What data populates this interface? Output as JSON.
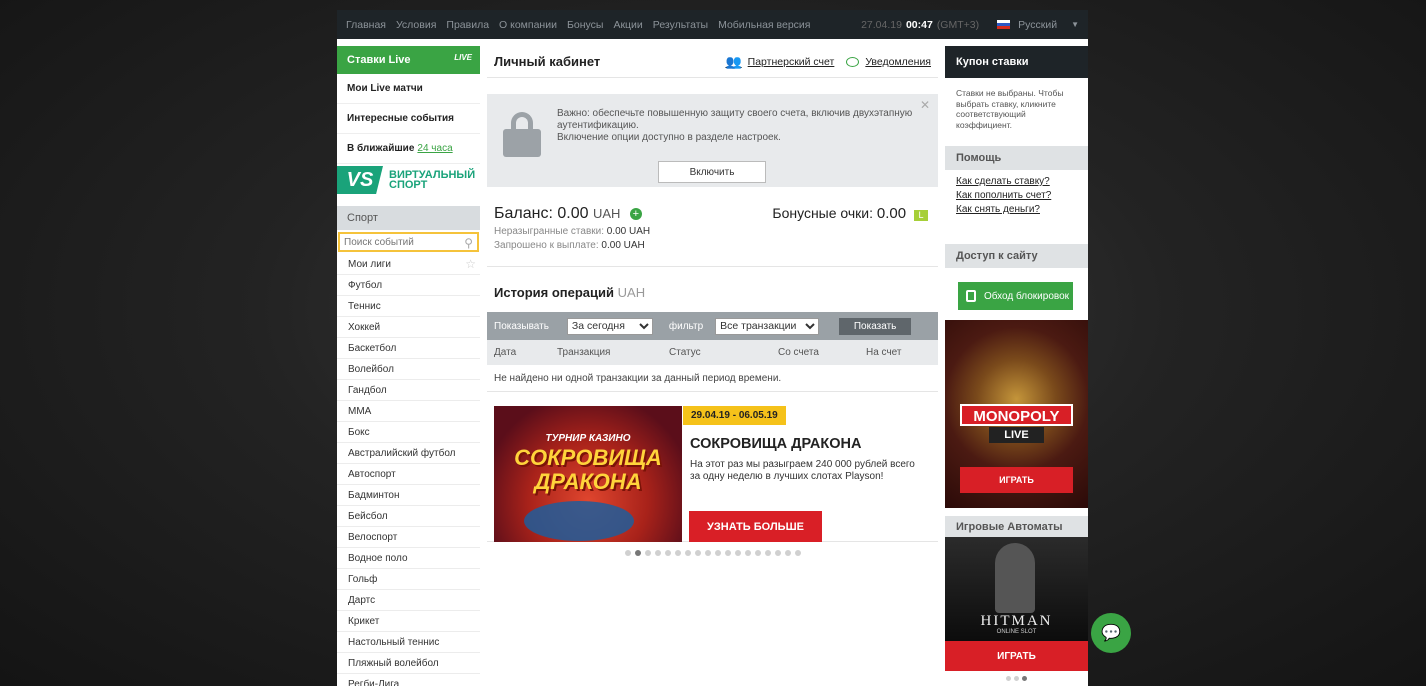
{
  "topnav": {
    "items": [
      "Главная",
      "Условия",
      "Правила",
      "О компании",
      "Бонусы",
      "Акции",
      "Результаты",
      "Мобильная версия"
    ],
    "date": "27.04.19",
    "time": "00:47",
    "timezone": "(GMT+3)",
    "language": "Русский"
  },
  "left": {
    "live_title": "Ставки Live",
    "live_badge": "LIVE",
    "my_live": "Мои Live матчи",
    "interesting": "Интересные события",
    "upcoming": "В ближайшие",
    "upcoming_link": "24 часа",
    "vs_logo": "VS",
    "vs_text_1": "ВИРТУАЛЬНЫЙ",
    "vs_text_2": "СПОРТ",
    "sport_header": "Спорт",
    "search_placeholder": "Поиск событий",
    "my_leagues": "Мои лиги",
    "sports": [
      "Футбол",
      "Теннис",
      "Хоккей",
      "Баскетбол",
      "Волейбол",
      "Гандбол",
      "ММА",
      "Бокс",
      "Австралийский футбол",
      "Автоспорт",
      "Бадминтон",
      "Бейсбол",
      "Велоспорт",
      "Водное поло",
      "Гольф",
      "Дартс",
      "Крикет",
      "Настольный теннис",
      "Пляжный волейбол",
      "Регби-Лига"
    ]
  },
  "main": {
    "title": "Личный кабинет",
    "partner_link": "Партнерский счет",
    "notifications_link": "Уведомления",
    "notice_text_1": "Важно: обеспечьте повышенную защиту своего счета, включив двухэтапную аутентификацию.",
    "notice_text_2": "Включение опции доступно в разделе настроек.",
    "enable_btn": "Включить",
    "balance_label": "Баланс:",
    "balance_value": "0.00",
    "balance_unit": "UAH",
    "unplayed_label": "Неразыгранные ставки:",
    "unplayed_value": "0.00 UAH",
    "requested_label": "Запрошено к выплате:",
    "requested_value": "0.00 UAH",
    "bonus_label": "Бонусные очки:",
    "bonus_value": "0.00",
    "bonus_badge": "L",
    "history_title": "История операций",
    "history_unit": "UAH",
    "filter_show_label": "Показывать",
    "filter_period": "За сегодня",
    "filter_label": "фильтр",
    "filter_type": "Все транзакции",
    "show_btn": "Показать",
    "columns": [
      "Дата",
      "Транзакция",
      "Статус",
      "Со счета",
      "На счет"
    ],
    "empty_text": "Не найдено ни одной транзакции за данный период времени.",
    "promo": {
      "img_line1": "ТУРНИР КАЗИНО",
      "img_line2": "СОКРОВИЩА",
      "img_line3": "ДРАКОНА",
      "dates": "29.04.19 - 06.05.19",
      "title": "СОКРОВИЩА ДРАКОНА",
      "text": "На этот раз мы разыграем 240 000 рублей всего за одну неделю в лучших слотах Playson!",
      "btn": "УЗНАТЬ БОЛЬШЕ"
    },
    "dots_total": 18,
    "dots_active": 2
  },
  "right": {
    "coupon_title": "Купон ставки",
    "coupon_text": "Ставки не выбраны. Чтобы выбрать ставку, кликните соответствующий коэффициент.",
    "help_title": "Помощь",
    "help_links": [
      "Как сделать ставку?",
      "Как пополнить счет?",
      "Как снять деньги?"
    ],
    "access_title": "Доступ к сайту",
    "block_btn": "Обход блокировок",
    "monopoly_logo": "MONOPOLY",
    "monopoly_sub": "LIVE",
    "monopoly_play": "ИГРАТЬ",
    "slots_title": "Игровые Автоматы",
    "hitman_title": "HITMAN",
    "hitman_sub": "ONLINE SLOT",
    "hitman_play": "ИГРАТЬ"
  },
  "colors": {
    "brand_green": "#3aa444",
    "cta_red": "#d91f26",
    "date_yellow": "#f5c21a"
  }
}
